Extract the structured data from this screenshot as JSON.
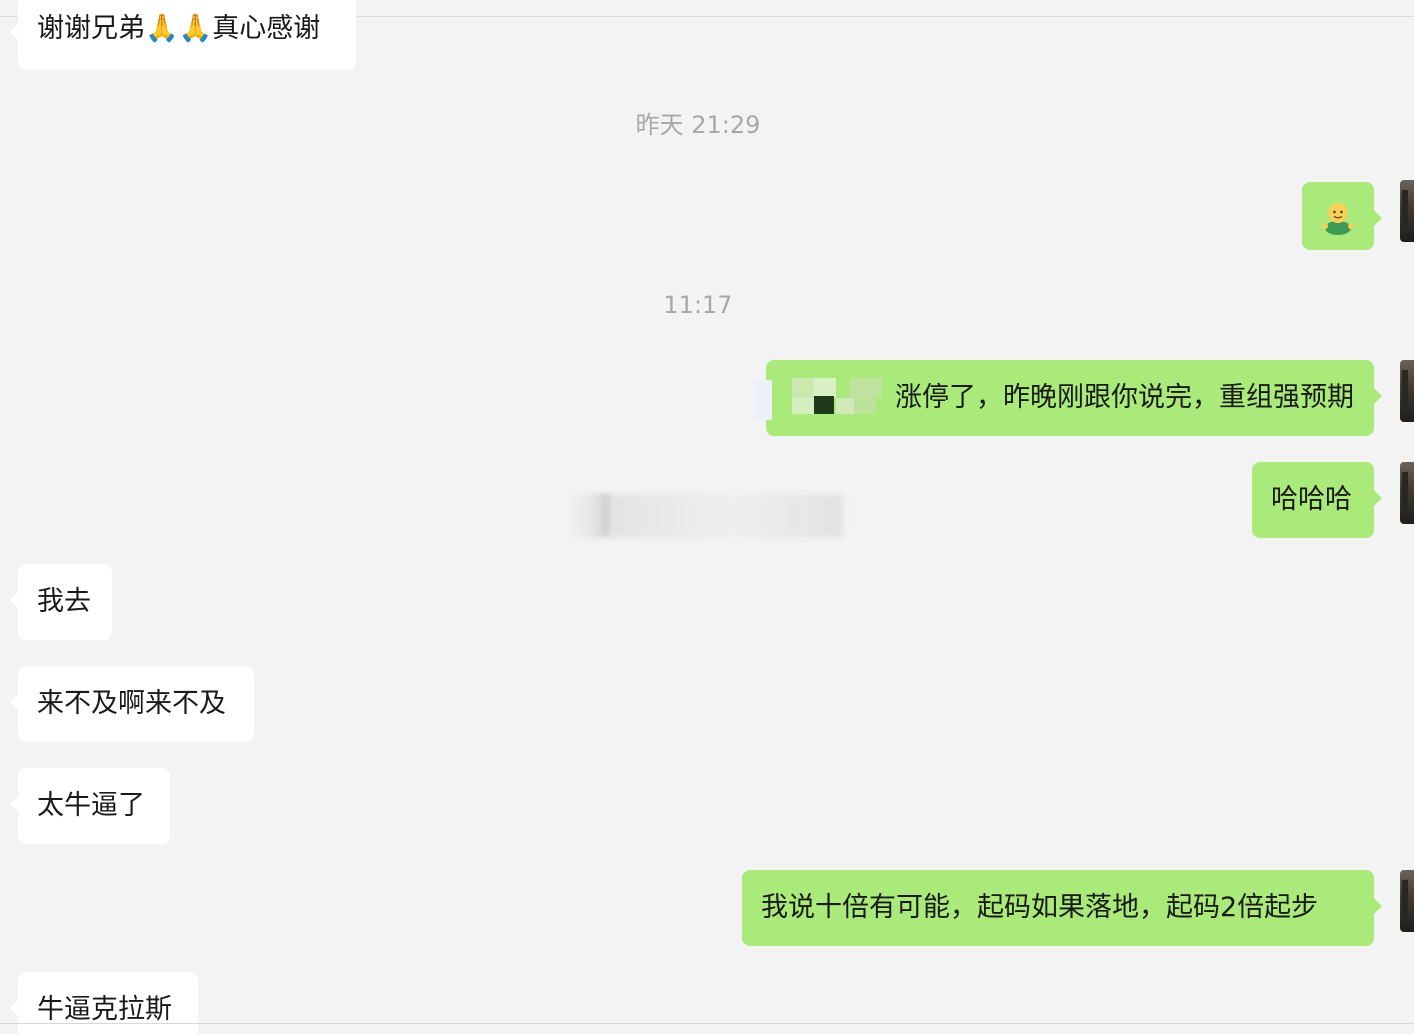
{
  "messages": {
    "m1": {
      "text": "谢谢兄弟🙏🙏真心感谢"
    },
    "t1": {
      "text": "昨天 21:29"
    },
    "m2": {
      "emoji": "smiling-person-sticker"
    },
    "t2": {
      "text": "11:17"
    },
    "m3": {
      "text": "涨停了，昨晚刚跟你说完，重组强预期"
    },
    "m4": {
      "text": "哈哈哈"
    },
    "m5": {
      "text": "我去"
    },
    "m6": {
      "text": "来不及啊来不及"
    },
    "m7": {
      "text": "太牛逼了"
    },
    "m8": {
      "text": "我说十倍有可能，起码如果落地，起码2倍起步"
    },
    "m9": {
      "text": "牛逼克拉斯"
    }
  },
  "colors": {
    "background": "#f3f3f3",
    "incoming_bubble": "#ffffff",
    "outgoing_bubble": "#a9ea7a",
    "timestamp_text": "#a8a8a8"
  }
}
